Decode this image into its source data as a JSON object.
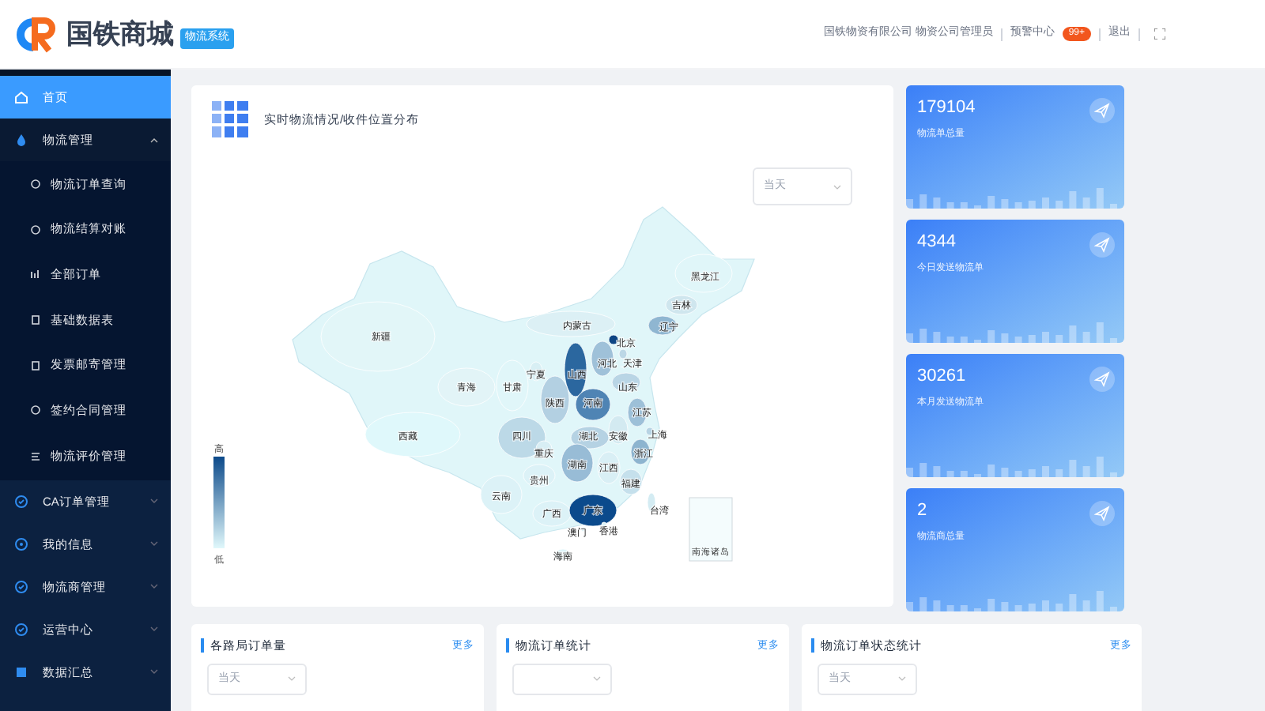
{
  "header": {
    "logo_text": "国铁商城",
    "logo_badge": "物流系统",
    "user": "国铁物资有限公司 物资公司管理员",
    "alerts": "预警中心",
    "alerts_count": "99+",
    "logout": "退出"
  },
  "sidebar": {
    "items": [
      {
        "label": "首页",
        "selected": true
      },
      {
        "label": "物流管理",
        "selected": false,
        "expanded": true,
        "children": [
          {
            "label": "物流订单查询"
          },
          {
            "label": "物流结算对账"
          },
          {
            "label": "全部订单"
          },
          {
            "label": "基础数据表"
          },
          {
            "label": "发票邮寄管理"
          },
          {
            "label": "签约合同管理"
          },
          {
            "label": "物流评价管理"
          }
        ]
      },
      {
        "label": "CA订单管理",
        "selected": false,
        "expanded": false
      },
      {
        "label": "我的信息",
        "selected": false,
        "expanded": false
      },
      {
        "label": "物流商管理",
        "selected": false,
        "expanded": false
      },
      {
        "label": "运营中心",
        "selected": false,
        "expanded": false
      },
      {
        "label": "数据汇总",
        "selected": false,
        "expanded": false
      }
    ]
  },
  "map_panel": {
    "title": "实时物流情况/收件位置分布",
    "period": "当天",
    "legend_high": "高",
    "legend_low": "低",
    "inset_label": "南海诸岛",
    "provinces": [
      {
        "name": "黑龙江",
        "color": "#e0f6f9"
      },
      {
        "name": "吉林",
        "color": "#cfe6ee"
      },
      {
        "name": "内蒙古",
        "color": "#dcf0f5"
      },
      {
        "name": "辽宁",
        "color": "#8fb6d1"
      },
      {
        "name": "新疆",
        "color": "#e2f6f8"
      },
      {
        "name": "北京",
        "color": "#0d4584"
      },
      {
        "name": "河北",
        "color": "#9fc1d9"
      },
      {
        "name": "天津",
        "color": "#bcd7e6"
      },
      {
        "name": "宁夏",
        "color": "#d8eff4"
      },
      {
        "name": "山西",
        "color": "#2b679f"
      },
      {
        "name": "青海",
        "color": "#e2f4f7"
      },
      {
        "name": "甘肃",
        "color": "#e0f6f9"
      },
      {
        "name": "山东",
        "color": "#b9d5e5"
      },
      {
        "name": "陕西",
        "color": "#b3d0e2"
      },
      {
        "name": "河南",
        "color": "#4f84b4"
      },
      {
        "name": "江苏",
        "color": "#9dc0d8"
      },
      {
        "name": "西藏",
        "color": "#dff8fb"
      },
      {
        "name": "四川",
        "color": "#bcd9e7"
      },
      {
        "name": "湖北",
        "color": "#b5d2e3"
      },
      {
        "name": "安徽",
        "color": "#d3eaf1"
      },
      {
        "name": "上海",
        "color": "#b7d4e4"
      },
      {
        "name": "重庆",
        "color": "#d8eef4"
      },
      {
        "name": "浙江",
        "color": "#8db4cf"
      },
      {
        "name": "湖南",
        "color": "#98bcd6"
      },
      {
        "name": "江西",
        "color": "#d9eff5"
      },
      {
        "name": "贵州",
        "color": "#dcf2f7"
      },
      {
        "name": "福建",
        "color": "#c5e0ec"
      },
      {
        "name": "云南",
        "color": "#dcf2f7"
      },
      {
        "name": "广西",
        "color": "#dcf2f7"
      },
      {
        "name": "广东",
        "color": "#0b4a8c"
      },
      {
        "name": "台湾",
        "color": "#d4ecf3"
      },
      {
        "name": "澳门",
        "color": "#dcf2f7"
      },
      {
        "name": "香港",
        "color": "#dcf2f7"
      },
      {
        "name": "海南",
        "color": "#dff5f9"
      }
    ]
  },
  "stats": [
    {
      "value": "179104",
      "label": "物流单总量"
    },
    {
      "value": "4344",
      "label": "今日发送物流单"
    },
    {
      "value": "30261",
      "label": "本月发送物流单"
    },
    {
      "value": "2",
      "label": "物流商总量"
    }
  ],
  "bottom_cards": [
    {
      "title": "各路局订单量",
      "more": "更多",
      "period": "当天"
    },
    {
      "title": "物流订单统计",
      "more": "更多"
    },
    {
      "title": "物流订单状态统计",
      "more": "更多",
      "period": "当天"
    }
  ]
}
